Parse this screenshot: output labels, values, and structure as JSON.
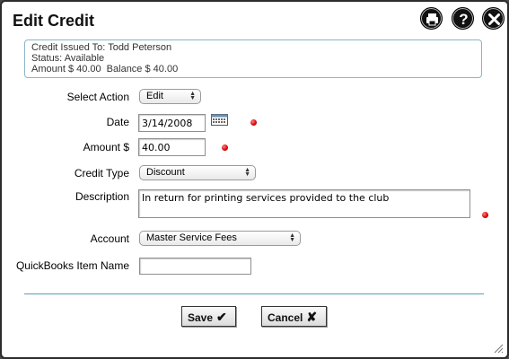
{
  "dialog": {
    "title": "Edit Credit"
  },
  "header_buttons": [
    {
      "name": "print-icon"
    },
    {
      "name": "help-icon",
      "glyph": "?"
    },
    {
      "name": "close-icon",
      "glyph": "✕"
    }
  ],
  "info": {
    "issued_to": "Credit Issued To: Todd Peterson",
    "status": "Status: Available",
    "amount": "Amount $ 40.00",
    "balance": "Balance $ 40.00"
  },
  "form": {
    "select_action": {
      "label": "Select Action",
      "value": "Edit"
    },
    "date": {
      "label": "Date",
      "value": "3/14/2008"
    },
    "amount": {
      "label": "Amount $",
      "value": "40.00"
    },
    "credit_type": {
      "label": "Credit Type",
      "value": "Discount"
    },
    "description": {
      "label": "Description",
      "value": "In return for printing services provided to the club"
    },
    "account": {
      "label": "Account",
      "value": "Master Service Fees"
    },
    "quickbooks_item": {
      "label": "QuickBooks Item Name",
      "value": ""
    }
  },
  "buttons": {
    "save": {
      "label": "Save",
      "glyph": "✔"
    },
    "cancel": {
      "label": "Cancel",
      "glyph": "✘"
    }
  },
  "colors": {
    "required_dot": "#d40000",
    "accent_border": "#5b9fb3"
  }
}
